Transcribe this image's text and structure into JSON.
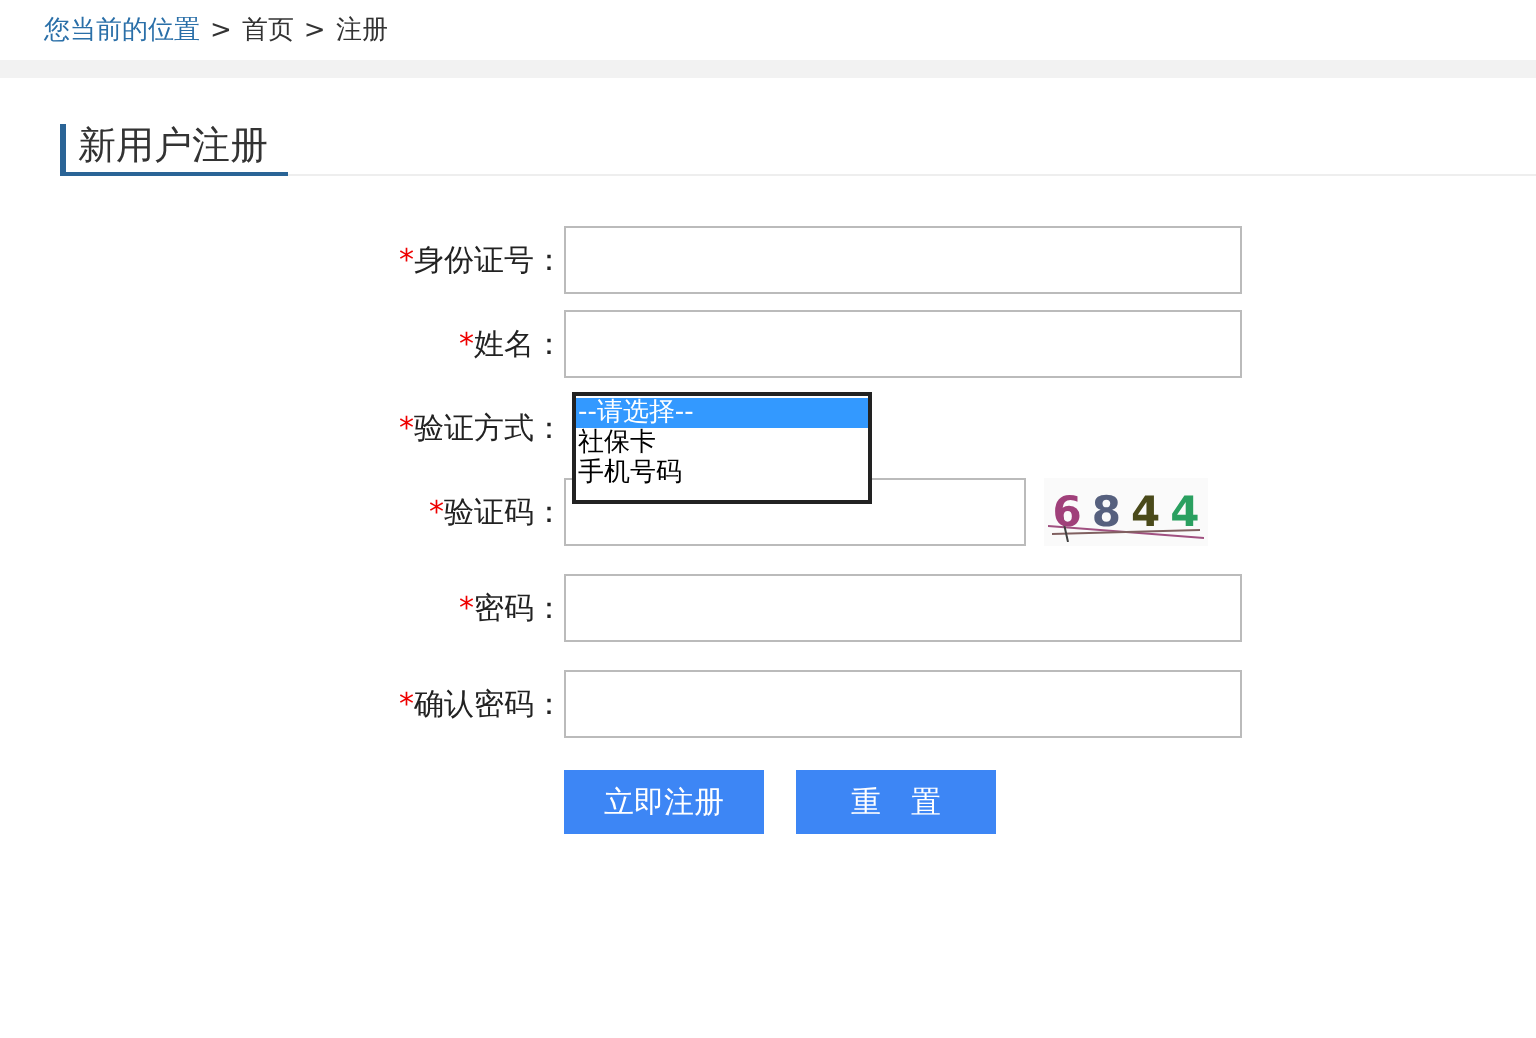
{
  "breadcrumb": {
    "label": "您当前的位置",
    "items": [
      "首页",
      "注册"
    ],
    "separator": ">"
  },
  "section_title": "新用户注册",
  "form": {
    "fields": [
      {
        "kind": "input",
        "required_mark": "*",
        "label": "身份证号："
      },
      {
        "kind": "input",
        "required_mark": "*",
        "label": "姓名："
      },
      {
        "kind": "listbox",
        "required_mark": "*",
        "label": "验证方式：",
        "options": [
          {
            "label": "--请选择--",
            "selected": true
          },
          {
            "label": "社保卡",
            "selected": false
          },
          {
            "label": "手机号码",
            "selected": false
          }
        ]
      },
      {
        "kind": "captcha",
        "required_mark": "*",
        "label": "验证码：",
        "captcha": [
          {
            "char": "6",
            "color": "#a0407a"
          },
          {
            "char": "8",
            "color": "#56607e"
          },
          {
            "char": "4",
            "color": "#4a4a1a"
          },
          {
            "char": "4",
            "color": "#2aa060"
          }
        ]
      },
      {
        "kind": "input",
        "required_mark": "*",
        "label": "密码："
      },
      {
        "kind": "input",
        "required_mark": "*",
        "label": "确认密码："
      }
    ]
  },
  "buttons": [
    "立即注册",
    "重　置"
  ]
}
